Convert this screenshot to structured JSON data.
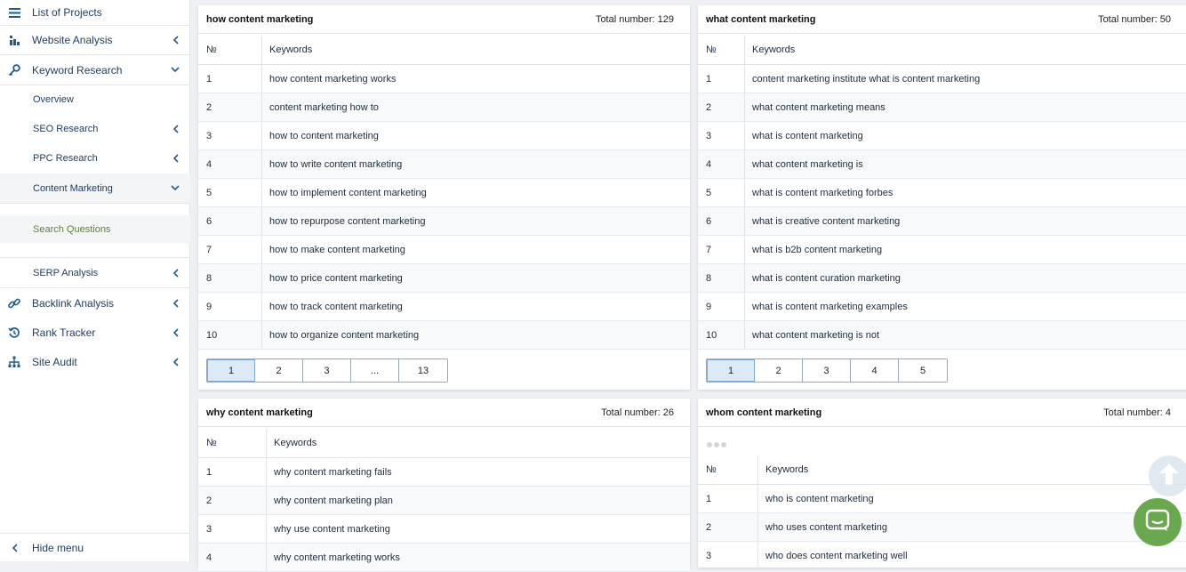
{
  "sidebar": {
    "list_projects": "List of Projects",
    "website_analysis": "Website Analysis",
    "keyword_research": "Keyword Research",
    "overview": "Overview",
    "seo_research": "SEO Research",
    "ppc_research": "PPC Research",
    "content_marketing": "Content Marketing",
    "search_questions": "Search Questions",
    "serp_analysis": "SERP Analysis",
    "backlink_analysis": "Backlink Analysis",
    "rank_tracker": "Rank Tracker",
    "site_audit": "Site Audit",
    "hide_menu": "Hide menu"
  },
  "colors": {
    "active_sub": "#5f7d3e",
    "chat_button": "#6aa84f",
    "nav_text": "#1f3a5c"
  },
  "col_no": "№",
  "col_keywords": "Keywords",
  "panels": {
    "how": {
      "title": "how content marketing",
      "total": "Total number: 129",
      "rows": [
        {
          "n": "1",
          "k": "how content marketing works"
        },
        {
          "n": "2",
          "k": "content marketing how to"
        },
        {
          "n": "3",
          "k": "how to content marketing"
        },
        {
          "n": "4",
          "k": "how to write content marketing"
        },
        {
          "n": "5",
          "k": "how to implement content marketing"
        },
        {
          "n": "6",
          "k": "how to repurpose content marketing"
        },
        {
          "n": "7",
          "k": "how to make content marketing"
        },
        {
          "n": "8",
          "k": "how to price content marketing"
        },
        {
          "n": "9",
          "k": "how to track content marketing"
        },
        {
          "n": "10",
          "k": "how to organize content marketing"
        }
      ],
      "pages": [
        "1",
        "2",
        "3",
        "...",
        "13"
      ]
    },
    "what": {
      "title": "what content marketing",
      "total": "Total number: 50",
      "rows": [
        {
          "n": "1",
          "k": "content marketing institute what is content marketing"
        },
        {
          "n": "2",
          "k": "what content marketing means"
        },
        {
          "n": "3",
          "k": "what is content marketing"
        },
        {
          "n": "4",
          "k": "what content marketing is"
        },
        {
          "n": "5",
          "k": "what is content marketing forbes"
        },
        {
          "n": "6",
          "k": "what is creative content marketing"
        },
        {
          "n": "7",
          "k": "what is b2b content marketing"
        },
        {
          "n": "8",
          "k": "what is content curation marketing"
        },
        {
          "n": "9",
          "k": "what is content marketing examples"
        },
        {
          "n": "10",
          "k": "what content marketing is not"
        }
      ],
      "pages": [
        "1",
        "2",
        "3",
        "4",
        "5"
      ]
    },
    "why": {
      "title": "why content marketing",
      "total": "Total number: 26",
      "rows": [
        {
          "n": "1",
          "k": "why content marketing fails"
        },
        {
          "n": "2",
          "k": "why content marketing plan"
        },
        {
          "n": "3",
          "k": "why use content marketing"
        },
        {
          "n": "4",
          "k": "why content marketing works"
        }
      ]
    },
    "whom": {
      "title": "whom content marketing",
      "total": "Total number: 4",
      "rows": [
        {
          "n": "1",
          "k": "who is content marketing"
        },
        {
          "n": "2",
          "k": "who uses content marketing"
        },
        {
          "n": "3",
          "k": "who does content marketing well"
        }
      ]
    }
  }
}
